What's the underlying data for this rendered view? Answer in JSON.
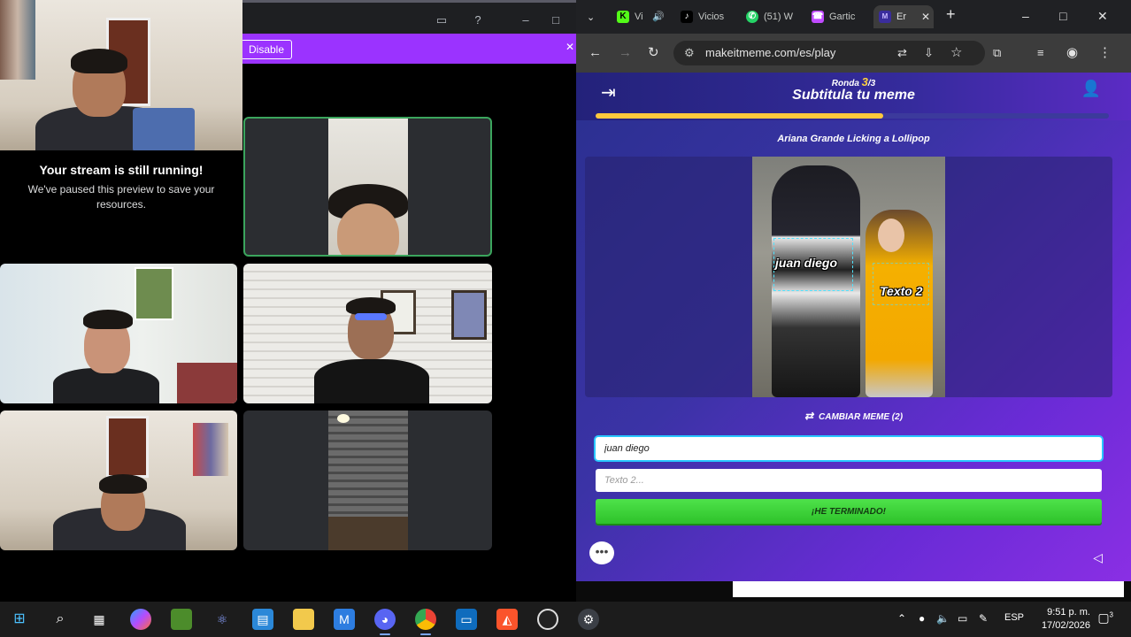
{
  "left_window": {
    "disable_label": "Disable",
    "paused_title": "Your stream is still running!",
    "paused_message": "We've paused this preview to save your resources."
  },
  "browser": {
    "tabs": [
      {
        "label": "Vi",
        "icon": "kick-icon",
        "color": "#53fc18"
      },
      {
        "label": "Vicios",
        "icon": "tiktok-icon",
        "color": "#ffffff"
      },
      {
        "label": "(51) W",
        "icon": "whatsapp-icon",
        "color": "#25d366"
      },
      {
        "label": "Gartic",
        "icon": "gartic-phone-icon",
        "color": "#c04bff"
      },
      {
        "label": "Er",
        "icon": "makeitmeme-icon",
        "color": "#c8b8ff"
      }
    ],
    "url": "makeitmeme.com/es/play"
  },
  "game": {
    "round_prefix": "Ronda",
    "round_current": "3",
    "round_total": "/3",
    "title": "Subtitula tu meme",
    "progress": 0.56,
    "meme_name": "Ariana Grande Licking a Lollipop",
    "caption_1": "juan diego",
    "caption_2": "Texto 2",
    "change_meme_label": "CAMBIAR MEME (2)",
    "input_1_value": "juan diego",
    "input_2_placeholder": "Texto 2...",
    "done_label": "¡HE TERMINADO!"
  },
  "taskbar": {
    "language": "ESP",
    "time": "9:51 p. m.",
    "date": "17/02/2026",
    "notification_count": "3"
  },
  "colors": {
    "accent_purple": "#9b33ff",
    "progress_yellow": "#ffc93c",
    "done_green": "#3ed33a",
    "active_tile_border": "#3ba55d"
  }
}
